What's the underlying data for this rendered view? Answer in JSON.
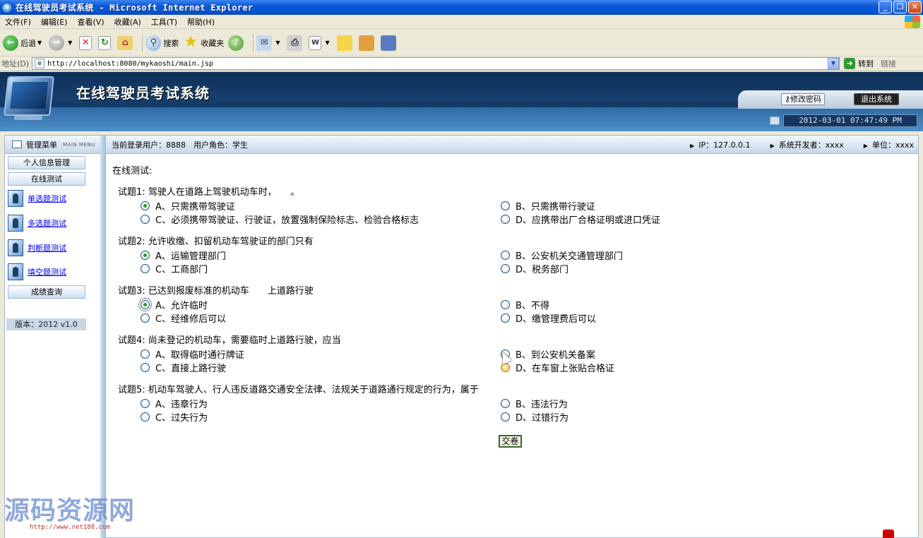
{
  "window": {
    "title": "在线驾驶员考试系统 - Microsoft Internet Explorer",
    "controls": [
      "_",
      "❐",
      "✕"
    ]
  },
  "menubar": [
    "文件(F)",
    "编辑(E)",
    "查看(V)",
    "收藏(A)",
    "工具(T)",
    "帮助(H)"
  ],
  "toolbar": {
    "back_label": "后退",
    "search_label": "搜索",
    "favorites_label": "收藏夹"
  },
  "addressbar": {
    "label": "地址(D)",
    "url": "http://localhost:8080/mykaoshi/main.jsp",
    "go_label": "转到",
    "links_label": "链接"
  },
  "app": {
    "title": "在线驾驶员考试系统",
    "change_password": "修改密码",
    "logout": "退出系统",
    "datetime": "2012-03-01 07:47:49 PM"
  },
  "infobar": {
    "menu_title": "管理菜单",
    "menu_title_en": "MAIN MENU",
    "current_user": "当前登录用户：8888　用户角色：学生",
    "ip": "IP：127.0.0.1",
    "developer": "系统开发者：xxxx",
    "unit": "单位：xxxx"
  },
  "sidebar": {
    "personal_info": "个人信息管理",
    "online_test": "在线测试",
    "links": [
      "单选题测试",
      "多选题测试",
      "判断题测试",
      "填空题测试"
    ],
    "scores": "成绩查询",
    "version": "版本：2012 v1.0"
  },
  "content": {
    "section_title": "在线测试:",
    "submit": "交卷",
    "questions": [
      {
        "title": "试题1: 驾驶人在道路上驾驶机动车时，　　。",
        "options": [
          "A、只需携带驾驶证",
          "B、只需携带行驶证",
          "C、必须携带驾驶证、行驶证，放置强制保险标志、检验合格标志",
          "D、应携带出厂合格证明或进口凭证"
        ],
        "selected": 0
      },
      {
        "title": "试题2: 允许收缴、扣留机动车驾驶证的部门只有",
        "options": [
          "A、运输管理部门",
          "B、公安机关交通管理部门",
          "C、工商部门",
          "D、税务部门"
        ],
        "selected": 0
      },
      {
        "title": "试题3: 已达到报废标准的机动车　　上道路行驶",
        "options": [
          "A、允许临时",
          "B、不得",
          "C、经维修后可以",
          "D、缴管理费后可以"
        ],
        "selected": 0
      },
      {
        "title": "试题4: 尚未登记的机动车，需要临时上道路行驶，应当",
        "options": [
          "A、取得临时通行牌证",
          "B、到公安机关备案",
          "C、直接上路行驶",
          "D、在车窗上张贴合格证"
        ],
        "selected": -1
      },
      {
        "title": "试题5: 机动车驾驶人、行人违反道路交通安全法律、法规关于道路通行规定的行为，属于",
        "options": [
          "A、违章行为",
          "B、违法行为",
          "C、过失行为",
          "D、过错行为"
        ],
        "selected": -1
      }
    ]
  },
  "watermark": {
    "title": "源码资源网",
    "url": "http://www.net188.com"
  },
  "icons": {
    "back": "back-arrow-icon",
    "forward": "forward-arrow-icon",
    "stop": "stop-icon",
    "refresh": "refresh-icon",
    "home": "home-icon",
    "search": "search-icon",
    "favorites": "star-icon",
    "media": "media-icon",
    "mail": "mail-icon",
    "print": "printer-icon",
    "edit": "edit-icon",
    "go": "go-arrow-icon"
  },
  "colors": {
    "titlebar": "#0653d4",
    "banner": "#0f3460",
    "link": "#0000ee",
    "radio_checked": "#21a121"
  }
}
